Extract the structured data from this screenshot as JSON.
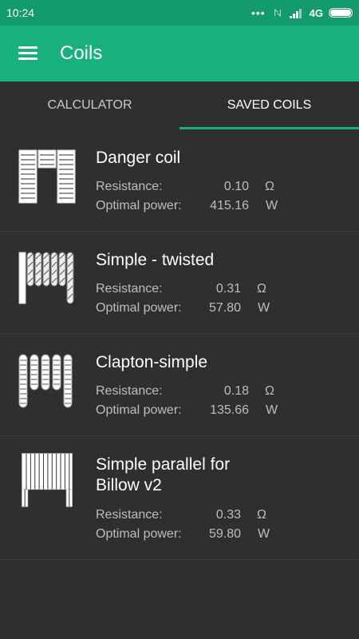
{
  "status_bar": {
    "time": "10:24",
    "network": "4G"
  },
  "app_bar": {
    "title": "Coils"
  },
  "tabs": [
    {
      "label": "CALCULATOR"
    },
    {
      "label": "SAVED COILS"
    }
  ],
  "coils": [
    {
      "name": "Danger coil",
      "resistance_label": "Resistance:",
      "resistance": "0.10",
      "resistance_unit": "Ω",
      "power_label": "Optimal power:",
      "power": "415.16",
      "power_unit": "W"
    },
    {
      "name": "Simple - twisted",
      "resistance_label": "Resistance:",
      "resistance": "0.31",
      "resistance_unit": "Ω",
      "power_label": "Optimal power:",
      "power": "57.80",
      "power_unit": "W"
    },
    {
      "name": "Clapton-simple",
      "resistance_label": "Resistance:",
      "resistance": "0.18",
      "resistance_unit": "Ω",
      "power_label": "Optimal power:",
      "power": "135.66",
      "power_unit": "W"
    },
    {
      "name": "Simple parallel for Billow v2",
      "resistance_label": "Resistance:",
      "resistance": "0.33",
      "resistance_unit": "Ω",
      "power_label": "Optimal power:",
      "power": "59.80",
      "power_unit": "W"
    }
  ],
  "colors": {
    "accent": "#18b07f",
    "status_bar": "#139b6f",
    "background": "#2f2f2f"
  }
}
